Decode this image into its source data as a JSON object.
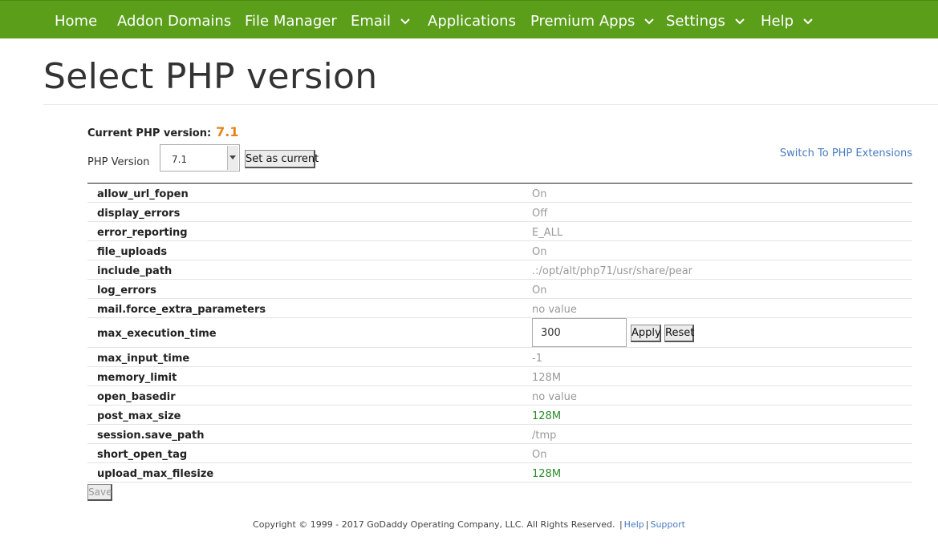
{
  "nav": {
    "items": [
      {
        "label": "Home",
        "dropdown": false
      },
      {
        "label": "Addon Domains",
        "dropdown": false
      },
      {
        "label": "File Manager",
        "dropdown": false
      },
      {
        "label": "Email",
        "dropdown": true
      },
      {
        "label": "Applications",
        "dropdown": false
      },
      {
        "label": "Premium Apps",
        "dropdown": true
      },
      {
        "label": "Settings",
        "dropdown": true
      },
      {
        "label": "Help",
        "dropdown": true
      }
    ],
    "bg_color": "#5a9e1a"
  },
  "page": {
    "title": "Select PHP version",
    "current_label": "Current PHP version:",
    "current_value": "7.1",
    "version_label": "PHP Version",
    "version_select_value": "7.1",
    "set_current_label": "Set as current",
    "switch_link": "Switch To PHP Extensions",
    "accent_color": "#e8801a"
  },
  "options": [
    {
      "name": "allow_url_fopen",
      "value": "On",
      "changed": false
    },
    {
      "name": "display_errors",
      "value": "Off",
      "changed": false
    },
    {
      "name": "error_reporting",
      "value": "E_ALL",
      "changed": false
    },
    {
      "name": "file_uploads",
      "value": "On",
      "changed": false
    },
    {
      "name": "include_path",
      "value": ".:/opt/alt/php71/usr/share/pear",
      "changed": false
    },
    {
      "name": "log_errors",
      "value": "On",
      "changed": false
    },
    {
      "name": "mail.force_extra_parameters",
      "value": "no value",
      "changed": false
    },
    {
      "name": "max_execution_time",
      "value": "300",
      "editing": true
    },
    {
      "name": "max_input_time",
      "value": "-1",
      "changed": false
    },
    {
      "name": "memory_limit",
      "value": "128M",
      "changed": false
    },
    {
      "name": "open_basedir",
      "value": "no value",
      "changed": false
    },
    {
      "name": "post_max_size",
      "value": "128M",
      "changed": true
    },
    {
      "name": "session.save_path",
      "value": "/tmp",
      "changed": false
    },
    {
      "name": "short_open_tag",
      "value": "On",
      "changed": false
    },
    {
      "name": "upload_max_filesize",
      "value": "128M",
      "changed": true
    }
  ],
  "edit_buttons": {
    "apply": "Apply",
    "reset": "Reset"
  },
  "save_label": "Save",
  "footer": {
    "copyright": "Copyright © 1999 - 2017 GoDaddy Operating Company, LLC. All Rights Reserved.",
    "separator": "|",
    "help": "Help",
    "support": "Support"
  }
}
